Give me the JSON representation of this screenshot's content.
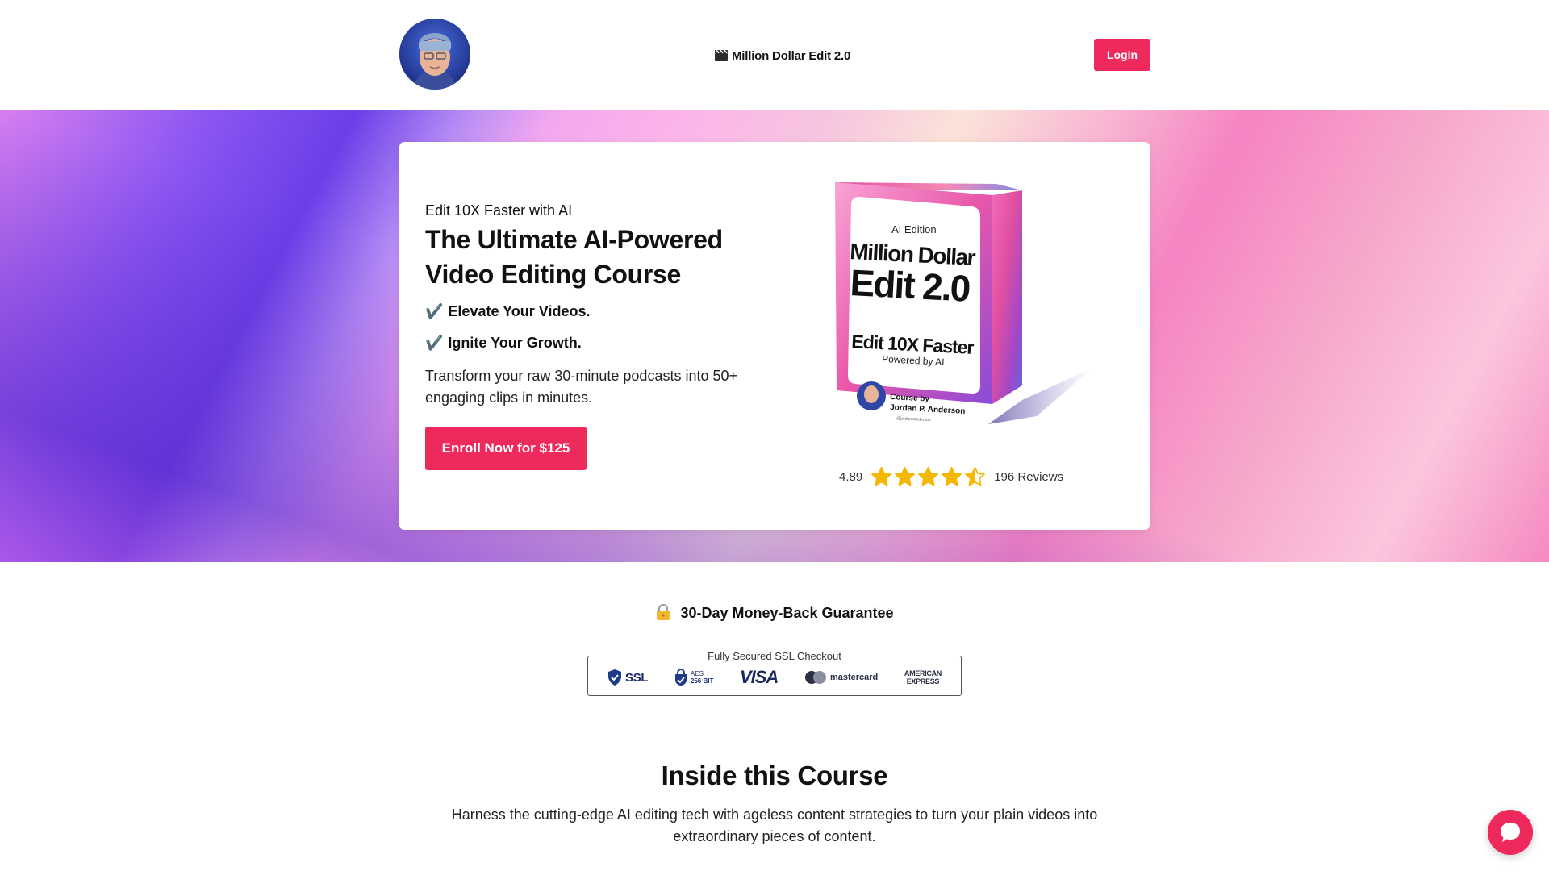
{
  "header": {
    "brand_emoji": "🎬",
    "brand_title": "Million Dollar Edit 2.0",
    "login_label": "Login"
  },
  "hero": {
    "eyebrow": "Edit 10X Faster with AI",
    "headline": "The Ultimate AI-Powered Video Editing Course",
    "checks": [
      {
        "mark": "✔️",
        "text": "Elevate Your Videos."
      },
      {
        "mark": "✔️",
        "text": "Ignite Your Growth."
      }
    ],
    "description": "Transform your raw 30-minute podcasts into 50+ engaging clips in minutes.",
    "enroll_label": "Enroll Now for $125",
    "product": {
      "edition": "AI Edition",
      "title_line1": "Million Dollar",
      "title_line2": "Edit 2.0",
      "tagline": "Edit 10X Faster",
      "subtagline": "Powered by AI",
      "course_by": "Course by",
      "author": "Jordan P. Anderson",
      "handle": "@jordanpanderson"
    },
    "rating": {
      "score": "4.89",
      "stars_value": 4.5,
      "stars_max": 5,
      "reviews": "196 Reviews"
    }
  },
  "guarantee": {
    "icon": "lock-icon",
    "text": "30-Day Money-Back Guarantee"
  },
  "secure_checkout": {
    "legend": "Fully Secured SSL Checkout",
    "ssl": "SSL",
    "aes_top": "AES",
    "aes_bottom": "256 BIT",
    "visa": "VISA",
    "mastercard": "mastercard",
    "amex_top": "AMERICAN",
    "amex_bottom": "EXPRESS"
  },
  "course_section": {
    "title": "Inside this Course",
    "description": "Harness the cutting-edge AI editing tech with ageless content strategies to turn your plain videos into extraordinary pieces of content."
  },
  "colors": {
    "accent": "#ee2a5c",
    "text": "#111111",
    "star": "#f5b800"
  }
}
